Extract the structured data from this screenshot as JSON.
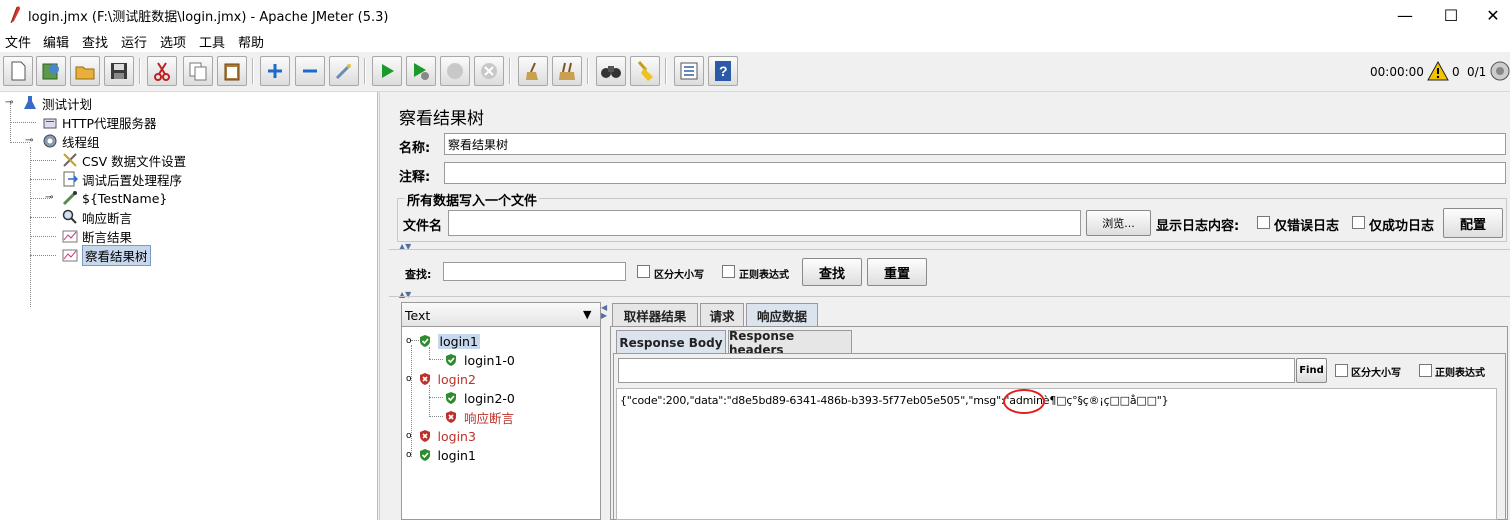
{
  "window": {
    "title": "login.jmx (F:\\测试脏数据\\login.jmx) - Apache JMeter (5.3)",
    "minimize": "—",
    "maximize": "☐",
    "close": "✕"
  },
  "menu": [
    "文件",
    "编辑",
    "查找",
    "运行",
    "选项",
    "工具",
    "帮助"
  ],
  "status": {
    "timer": "00:00:00",
    "warnings": "0",
    "threads": "0/1"
  },
  "tree": [
    {
      "label": "测试计划"
    },
    {
      "label": "HTTP代理服务器"
    },
    {
      "label": "线程组"
    },
    {
      "label": "CSV 数据文件设置"
    },
    {
      "label": "调试后置处理程序"
    },
    {
      "label": "${TestName}"
    },
    {
      "label": "响应断言"
    },
    {
      "label": "断言结果"
    },
    {
      "label": "察看结果树"
    }
  ],
  "panel": {
    "heading": "察看结果树",
    "name_label": "名称:",
    "name_value": "察看结果树",
    "comment_label": "注释:",
    "comment_value": "",
    "file_group_title": "所有数据写入一个文件",
    "filename_label": "文件名",
    "filename_value": "",
    "browse_button": "浏览...",
    "log_display_label": "显示日志内容:",
    "errors_only": "仅错误日志",
    "success_only": "仅成功日志",
    "configure_button": "配置"
  },
  "search": {
    "label": "查找:",
    "value": "",
    "case_sensitive": "区分大小写",
    "regex": "正则表达式",
    "find_button": "查找",
    "reset_button": "重置"
  },
  "renderer": {
    "selected": "Text"
  },
  "results": [
    {
      "label": "login1",
      "status": "pass"
    },
    {
      "label": "login1-0",
      "status": "pass"
    },
    {
      "label": "login2",
      "status": "fail"
    },
    {
      "label": "login2-0",
      "status": "pass"
    },
    {
      "label": "响应断言",
      "status": "fail"
    },
    {
      "label": "login3",
      "status": "fail"
    },
    {
      "label": "login1",
      "status": "pass"
    }
  ],
  "result_tabs": [
    "取样器结果",
    "请求",
    "响应数据"
  ],
  "response_tabs": [
    "Response Body",
    "Response headers"
  ],
  "response_find": {
    "value": "",
    "find_button": "Find",
    "case_sensitive": "区分大小写",
    "regex": "正则表达式"
  },
  "response_body": "{\"code\":200,\"data\":\"d8e5bd89-6341-486b-b393-5f77eb05e505\",\"msg\":\"adminè¶□ç°§ç®¡ç□□å□□\"}",
  "colors": {
    "pass": "#2e8b2e",
    "fail": "#c0302a",
    "selection": "#c8d8ec",
    "annotation": "#e02020"
  }
}
